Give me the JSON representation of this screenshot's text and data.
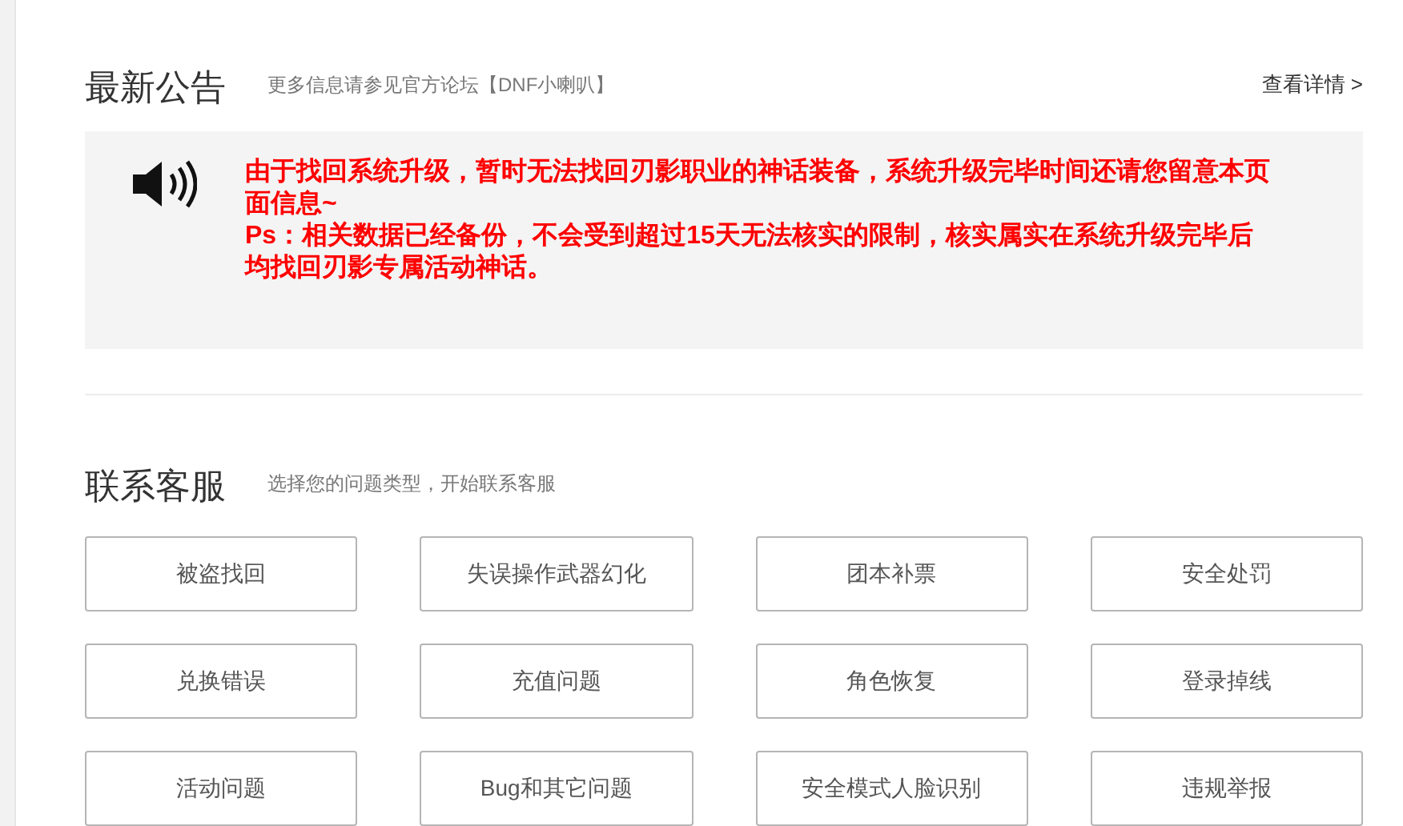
{
  "notice": {
    "title": "最新公告",
    "subtitle": "更多信息请参见官方论坛【DNF小喇叭】",
    "more_link": "查看详情 >",
    "messages": [
      "由于找回系统升级，暂时无法找回刃影职业的神话装备，系统升级完毕时间还请您留意本页面信息~",
      "Ps：相关数据已经备份，不会受到超过15天无法核实的限制，核实属实在系统升级完毕后均找回刃影专属活动神话。"
    ]
  },
  "support": {
    "title": "联系客服",
    "subtitle": "选择您的问题类型，开始联系客服",
    "options": [
      "被盗找回",
      "失误操作武器幻化",
      "团本补票",
      "安全处罚",
      "兑换错误",
      "充值问题",
      "角色恢复",
      "登录掉线",
      "活动问题",
      "Bug和其它问题",
      "安全模式人脸识别",
      "违规举报"
    ]
  }
}
